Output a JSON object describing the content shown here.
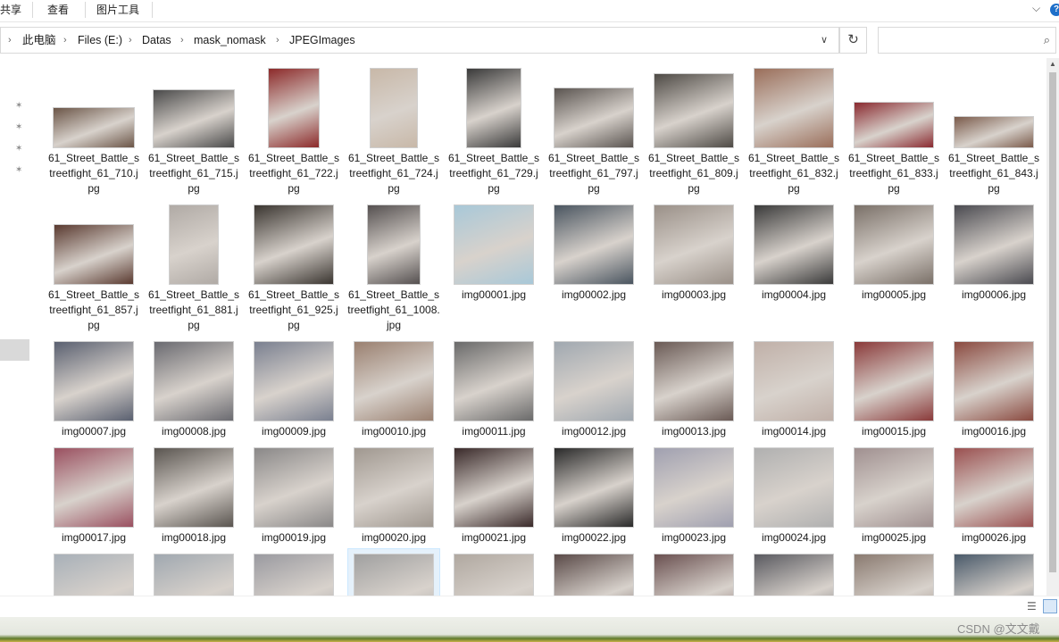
{
  "ribbon": {
    "tabs": [
      "共享",
      "查看",
      "图片工具"
    ]
  },
  "address": {
    "breadcrumbs": [
      "此电脑",
      "Files (E:)",
      "Datas",
      "mask_nomask",
      "JPEGImages"
    ],
    "search_placeholder": ""
  },
  "files": {
    "selected_index": 43,
    "items": [
      {
        "label": "61_Street_Battle_streetfight_61_710.jpg",
        "color": "#6b5547"
      },
      {
        "label": "61_Street_Battle_streetfight_61_715.jpg",
        "color": "#4a4a4a"
      },
      {
        "label": "61_Street_Battle_streetfight_61_722.jpg",
        "color": "#8c2a2a"
      },
      {
        "label": "61_Street_Battle_streetfight_61_724.jpg",
        "color": "#c8b8a8"
      },
      {
        "label": "61_Street_Battle_streetfight_61_729.jpg",
        "color": "#3a3a3a"
      },
      {
        "label": "61_Street_Battle_streetfight_61_797.jpg",
        "color": "#5a5450"
      },
      {
        "label": "61_Street_Battle_streetfight_61_809.jpg",
        "color": "#4e4a45"
      },
      {
        "label": "61_Street_Battle_streetfight_61_832.jpg",
        "color": "#9a6e5a"
      },
      {
        "label": "61_Street_Battle_streetfight_61_833.jpg",
        "color": "#8a2a30"
      },
      {
        "label": "61_Street_Battle_streetfight_61_843.jpg",
        "color": "#7a5a4a"
      },
      {
        "label": "61_Street_Battle_streetfight_61_857.jpg",
        "color": "#5a3a30"
      },
      {
        "label": "61_Street_Battle_streetfight_61_881.jpg",
        "color": "#b0aaa5"
      },
      {
        "label": "61_Street_Battle_streetfight_61_925.jpg",
        "color": "#3a3530"
      },
      {
        "label": "61_Street_Battle_streetfight_61_1008.jpg",
        "color": "#555050"
      },
      {
        "label": "img00001.jpg",
        "color": "#a8c8d8"
      },
      {
        "label": "img00002.jpg",
        "color": "#4a5560"
      },
      {
        "label": "img00003.jpg",
        "color": "#9a9088"
      },
      {
        "label": "img00004.jpg",
        "color": "#3a3a3a"
      },
      {
        "label": "img00005.jpg",
        "color": "#7a7068"
      },
      {
        "label": "img00006.jpg",
        "color": "#4a4a50"
      },
      {
        "label": "img00007.jpg",
        "color": "#5a6070"
      },
      {
        "label": "img00008.jpg",
        "color": "#6a6a70"
      },
      {
        "label": "img00009.jpg",
        "color": "#7a8090"
      },
      {
        "label": "img00010.jpg",
        "color": "#9a8070"
      },
      {
        "label": "img00011.jpg",
        "color": "#6a6a6a"
      },
      {
        "label": "img00012.jpg",
        "color": "#a0a8b0"
      },
      {
        "label": "img00013.jpg",
        "color": "#6a5a55"
      },
      {
        "label": "img00014.jpg",
        "color": "#c0b0a8"
      },
      {
        "label": "img00015.jpg",
        "color": "#8a3a3a"
      },
      {
        "label": "img00016.jpg",
        "color": "#8a4a40"
      },
      {
        "label": "img00017.jpg",
        "color": "#9a5060"
      },
      {
        "label": "img00018.jpg",
        "color": "#5a5550"
      },
      {
        "label": "img00019.jpg",
        "color": "#8a8888"
      },
      {
        "label": "img00020.jpg",
        "color": "#a09890"
      },
      {
        "label": "img00021.jpg",
        "color": "#3a2a2a"
      },
      {
        "label": "img00022.jpg",
        "color": "#2a2a2a"
      },
      {
        "label": "img00023.jpg",
        "color": "#a0a0b0"
      },
      {
        "label": "img00024.jpg",
        "color": "#b0b0b0"
      },
      {
        "label": "img00025.jpg",
        "color": "#a09090"
      },
      {
        "label": "img00026.jpg",
        "color": "#9a5050"
      },
      {
        "label": "",
        "color": "#a8b0b8"
      },
      {
        "label": "",
        "color": "#a0a8b0"
      },
      {
        "label": "",
        "color": "#9a9aa0"
      },
      {
        "label": "",
        "color": "#a0a0a0"
      },
      {
        "label": "",
        "color": "#b0a8a0"
      },
      {
        "label": "",
        "color": "#5a4a48"
      },
      {
        "label": "",
        "color": "#6a5050"
      },
      {
        "label": "",
        "color": "#5a5a60"
      },
      {
        "label": "",
        "color": "#8a7a70"
      },
      {
        "label": "",
        "color": "#4a5a6a"
      }
    ]
  },
  "watermark": "CSDN @文文戴"
}
